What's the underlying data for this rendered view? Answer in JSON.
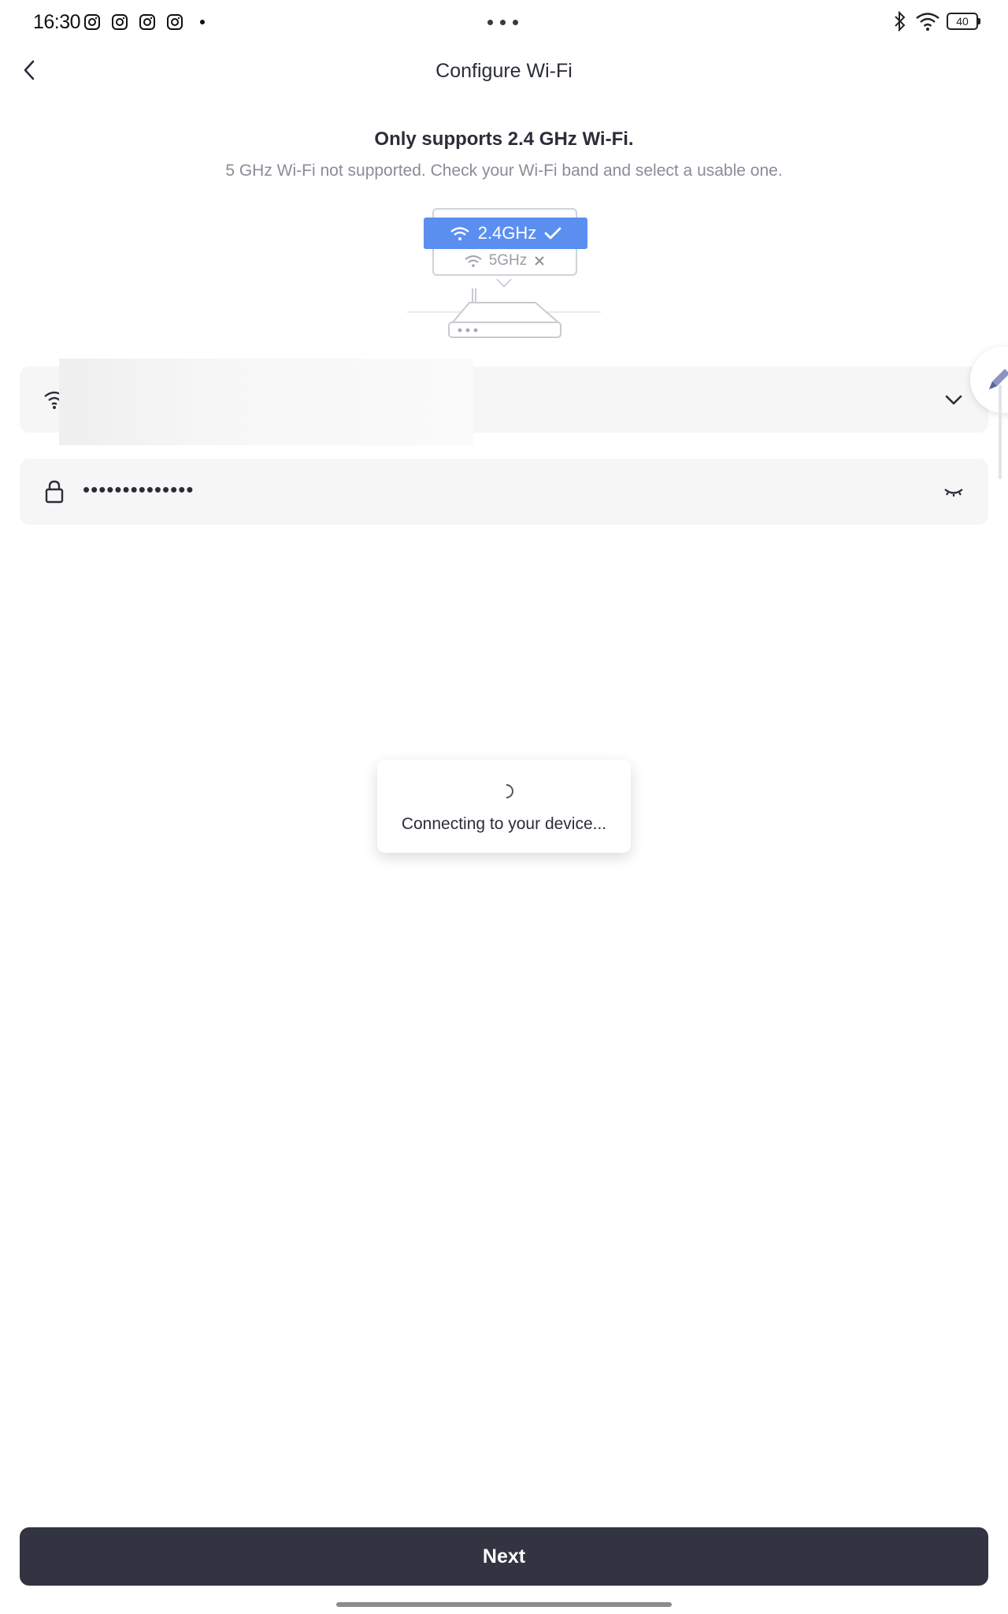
{
  "status_bar": {
    "time": "16:30",
    "battery": "40",
    "notification_icons": [
      "instagram-icon",
      "instagram-icon",
      "instagram-icon",
      "instagram-icon"
    ],
    "right_icons": [
      "bluetooth-icon",
      "wifi-icon",
      "battery-icon"
    ]
  },
  "header": {
    "title": "Configure Wi-Fi"
  },
  "hint": {
    "title": "Only supports 2.4 GHz Wi-Fi.",
    "subtitle": "5 GHz Wi-Fi not supported. Check your Wi-Fi band and select a usable one."
  },
  "illustration": {
    "band_supported": "2.4GHz",
    "band_unsupported": "5GHz",
    "accent_color": "#5a8ff0"
  },
  "wifi_field": {
    "ssid": ""
  },
  "password_field": {
    "value": "••••••••••••••"
  },
  "toast": {
    "message": "Connecting to your device..."
  },
  "footer": {
    "next_label": "Next",
    "button_color": "#323541"
  }
}
